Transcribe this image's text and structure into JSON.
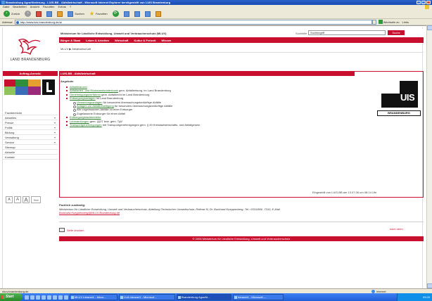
{
  "window": {
    "title": "Brandenburg Agrarförderung - LUIS-BB - Abfallwirtschaft - Microsoft Internet Explorer bereitgestellt von LUIS Brandenburg"
  },
  "menubar": [
    "Datei",
    "Bearbeiten",
    "Ansicht",
    "Favoriten",
    "Extras",
    "?"
  ],
  "toolbar": {
    "back": "Zurück",
    "search": "Suchen",
    "favorites": "Favoriten"
  },
  "addressbar": {
    "label": "Adresse",
    "url": "http://www.luis.brandenburg.de/a/",
    "go": "Wechseln zu",
    "links": "Links"
  },
  "page": {
    "logo_text": "LAND BRANDENBURG",
    "left_head": "Auftrag-Anmeld.",
    "left_nav": [
      {
        "label": "Fachbereiche",
        "chevron": ""
      },
      {
        "label": "Aktuelles",
        "chevron": "▾"
      },
      {
        "label": "Presse",
        "chevron": "▾"
      },
      {
        "label": "Politik",
        "chevron": "▾"
      },
      {
        "label": "Bildung",
        "chevron": "▾"
      },
      {
        "label": "Verwaltung",
        "chevron": "▾"
      },
      {
        "label": "Service",
        "chevron": "▾"
      },
      {
        "label": "Sitemap",
        "chevron": ""
      },
      {
        "label": "Aktuelle",
        "chevron": ""
      },
      {
        "label": "Kontakt",
        "chevron": ""
      }
    ],
    "font_ctrl": {
      "small": "A",
      "medium": "A",
      "large": "A",
      "text": "Text"
    },
    "ministry": "Ministerium für Ländliche Entwicklung, Umwelt und Verbraucherschutz (MLUV)",
    "search_label": "Suchhilfe",
    "search_value": "Suchbegriff",
    "search_button": "Suche",
    "nav": [
      "Bürger & Staat",
      "Leben & Arbeiten",
      "Wirtschaft",
      "Kultur & Freizeit",
      "Wissen"
    ],
    "breadcrumb": "MLUV  ▶  Abfallwirtschaft",
    "content_head": "LUIS-BB - Abfallwirtschaft",
    "sub_title": "Angebote",
    "items": [
      {
        "link": "Abfallbilanzen",
        "rest": "",
        "sub": false
      },
      {
        "link": "Abfallarten- und Rückstandsdatenbank",
        "rest": " gem. Abfallentsorg. im Land Brandenburg",
        "sub": false
      },
      {
        "link": "Genehmigungsverfahren",
        "rest": " gem. Abfallrecht im Land Brandenburg",
        "sub": false
      },
      {
        "link": "Entsorgungsanlagen",
        "rest": " im Land Brandenburg",
        "sub": false
      },
      {
        "link": "Verwertungsanlagen",
        "rest": " für besonders überwachungsbedürftige Abfälle",
        "sub": true
      },
      {
        "link": "Anlagen zur Abfallbeseitigung",
        "rest": " für besonders überwachungsbedürftige Abfälle",
        "sub": true
      },
      {
        "link": "",
        "rest": "Alle zugelassenen Abfälle zu einer Entsorger",
        "sub": true
      },
      {
        "link": "",
        "rest": "Zugelassene Entsorger für einen Abfall",
        "sub": true
      },
      {
        "link": "Entsorgungsfachbetriebe",
        "rest": "",
        "sub": false
      },
      {
        "link": "Lehrsamlungen",
        "rest": "  gem. §§37 bzw. gem. TgV",
        "sub": false
      },
      {
        "link": "Transportgenehmigungen",
        "rest": " mit Transportgenehmigungen gem. § 49 Kreislaufwirtschafts- und Abfallgesetz",
        "sub": false
      }
    ],
    "uis_logo_text": "UIS",
    "uis_sub": "BRANDENBURG",
    "stamp": "Eingestellt von LUIS-BB am 13.07.06 um 08:14 Uhr",
    "responsible_title": "Fachlich zuständig:",
    "responsible_text": "Ministerium für Ländliche Entwicklung, Umwelt und Verbraucherschutz, Abteilung Technischer Umweltschutz, Referat 5l, Dr. Burkhard Kueppenberg, Tel.: 0331/866 -7310, E-Mail",
    "responsible_mail": "Burkhard.Kueppenberg@MLUV.Brandenburg.de",
    "print": "Seite drucken",
    "to_top": "nach oben",
    "footer": "© 2006 Ministerium für Ländliche Entwicklung, Umwelt und Verbraucherschutz"
  },
  "statusbar": {
    "text": "nkuv.brandenburg.de",
    "zone": "Internet"
  },
  "taskbar": {
    "start": "Start",
    "tasks": [
      "MLUV Intranet1 - Micro...",
      "LUA Intranet1 - Microsof...",
      "Brandenburg Agrarfö...",
      "Intranet1 - Microsoft -..."
    ],
    "clock": "09:20"
  }
}
